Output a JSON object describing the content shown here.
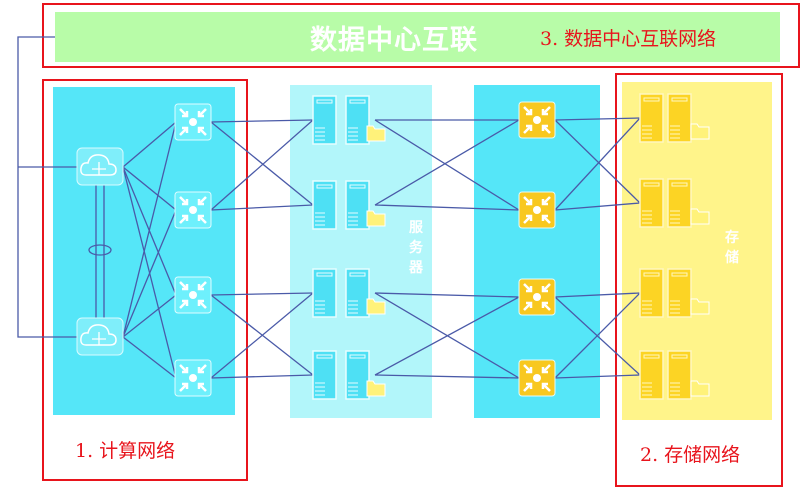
{
  "banner": {
    "title": "数据中心互联",
    "label": "3. 数据中心互联网络"
  },
  "compute": {
    "label": "1. 计算网络"
  },
  "servers": {
    "label": "服务器"
  },
  "storage": {
    "panel_label": "存储",
    "label": "2. 存储网络"
  },
  "colors": {
    "red": "#e8141c",
    "cyan": "#55e6f8",
    "light_cyan": "#b2f6fa",
    "green": "#b8fca8",
    "yellow": "#fff48a",
    "link": "#4a5aa8",
    "switch_orange": "#f8c820"
  }
}
